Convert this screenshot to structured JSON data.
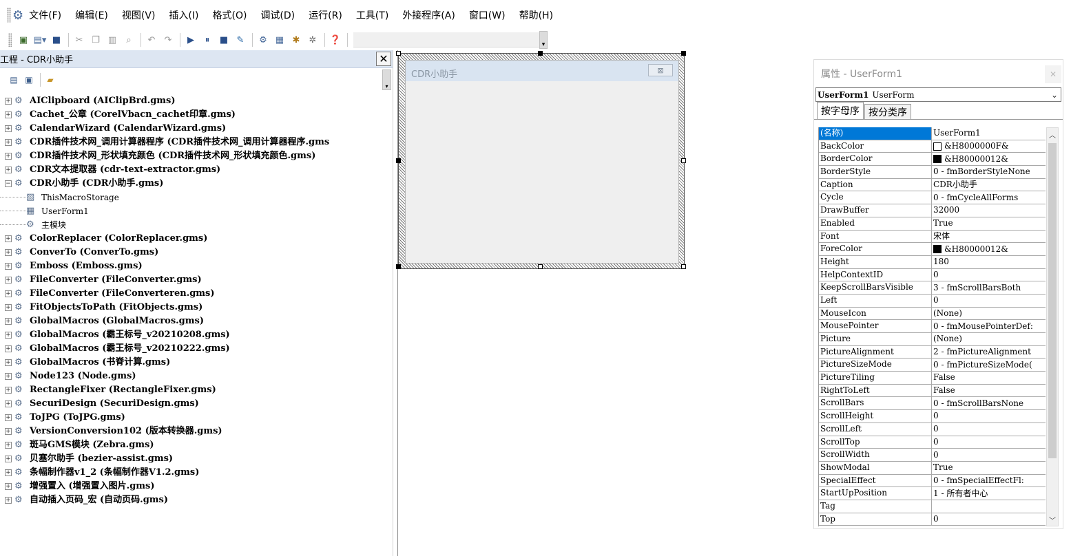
{
  "menu": {
    "items": [
      "文件(F)",
      "编辑(E)",
      "视图(V)",
      "插入(I)",
      "格式(O)",
      "调试(D)",
      "运行(R)",
      "工具(T)",
      "外接程序(A)",
      "窗口(W)",
      "帮助(H)"
    ]
  },
  "project": {
    "title": "工程 - CDR小助手",
    "items": [
      {
        "label": "AIClipboard (AIClipBrd.gms)",
        "expanded": false
      },
      {
        "label": "Cachet_公章 (CorelVbacn_cachet印章.gms)",
        "expanded": false
      },
      {
        "label": "CalendarWizard (CalendarWizard.gms)",
        "expanded": false
      },
      {
        "label": "CDR插件技术网_调用计算器程序 (CDR插件技术网_调用计算器程序.gms",
        "expanded": false
      },
      {
        "label": "CDR插件技术网_形状填充颜色 (CDR插件技术网_形状填充颜色.gms)",
        "expanded": false
      },
      {
        "label": "CDR文本提取器 (cdr-text-extractor.gms)",
        "expanded": false
      },
      {
        "label": "CDR小助手 (CDR小助手.gms)",
        "expanded": true
      },
      {
        "label": "ThisMacroStorage",
        "child": true,
        "icon": "document-icon"
      },
      {
        "label": "UserForm1",
        "child": true,
        "icon": "form-icon"
      },
      {
        "label": "主模块",
        "child": true,
        "icon": "module-icon"
      },
      {
        "label": "ColorReplacer (ColorReplacer.gms)",
        "expanded": false
      },
      {
        "label": "ConverTo (ConverTo.gms)",
        "expanded": false
      },
      {
        "label": "Emboss (Emboss.gms)",
        "expanded": false
      },
      {
        "label": "FileConverter (FileConverter.gms)",
        "expanded": false
      },
      {
        "label": "FileConverter (FileConverteren.gms)",
        "expanded": false
      },
      {
        "label": "FitObjectsToPath (FitObjects.gms)",
        "expanded": false
      },
      {
        "label": "GlobalMacros (GlobalMacros.gms)",
        "expanded": false
      },
      {
        "label": "GlobalMacros (霸王标号_v20210208.gms)",
        "expanded": false
      },
      {
        "label": "GlobalMacros (霸王标号_v20210222.gms)",
        "expanded": false
      },
      {
        "label": "GlobalMacros (书脊计算.gms)",
        "expanded": false
      },
      {
        "label": "Node123 (Node.gms)",
        "expanded": false
      },
      {
        "label": "RectangleFixer (RectangleFixer.gms)",
        "expanded": false
      },
      {
        "label": "SecuriDesign (SecuriDesign.gms)",
        "expanded": false
      },
      {
        "label": "ToJPG (ToJPG.gms)",
        "expanded": false
      },
      {
        "label": "VersionConversion102 (版本转换器.gms)",
        "expanded": false
      },
      {
        "label": "斑马GMS模块 (Zebra.gms)",
        "expanded": false
      },
      {
        "label": "贝塞尔助手 (bezier-assist.gms)",
        "expanded": false
      },
      {
        "label": "条幅制作器v1_2 (条幅制作器V1.2.gms)",
        "expanded": false
      },
      {
        "label": "增强置入 (增强置入图片.gms)",
        "expanded": false
      },
      {
        "label": "自动插入页码_宏 (自动页码.gms)",
        "expanded": false
      }
    ]
  },
  "userform": {
    "caption": "CDR小助手",
    "close_glyph": "⊠"
  },
  "properties": {
    "title": "属性 - UserForm1",
    "object_name": "UserForm1",
    "object_type": "UserForm",
    "tabs": [
      "按字母序",
      "按分类序"
    ],
    "rows": [
      {
        "name": "(名称)",
        "value": "UserForm1",
        "selected": true
      },
      {
        "name": "BackColor",
        "value": "&H8000000F&",
        "swatch": "#ffffff"
      },
      {
        "name": "BorderColor",
        "value": "&H80000012&",
        "swatch": "#000000"
      },
      {
        "name": "BorderStyle",
        "value": "0 - fmBorderStyleNone"
      },
      {
        "name": "Caption",
        "value": "CDR小助手"
      },
      {
        "name": "Cycle",
        "value": "0 - fmCycleAllForms"
      },
      {
        "name": "DrawBuffer",
        "value": "32000"
      },
      {
        "name": "Enabled",
        "value": "True"
      },
      {
        "name": "Font",
        "value": "宋体"
      },
      {
        "name": "ForeColor",
        "value": "&H80000012&",
        "swatch": "#000000"
      },
      {
        "name": "Height",
        "value": "180"
      },
      {
        "name": "HelpContextID",
        "value": "0"
      },
      {
        "name": "KeepScrollBarsVisible",
        "value": "3 - fmScrollBarsBoth"
      },
      {
        "name": "Left",
        "value": "0"
      },
      {
        "name": "MouseIcon",
        "value": "(None)"
      },
      {
        "name": "MousePointer",
        "value": "0 - fmMousePointerDef:"
      },
      {
        "name": "Picture",
        "value": "(None)"
      },
      {
        "name": "PictureAlignment",
        "value": "2 - fmPictureAlignment"
      },
      {
        "name": "PictureSizeMode",
        "value": "0 - fmPictureSizeMode("
      },
      {
        "name": "PictureTiling",
        "value": "False"
      },
      {
        "name": "RightToLeft",
        "value": "False"
      },
      {
        "name": "ScrollBars",
        "value": "0 - fmScrollBarsNone"
      },
      {
        "name": "ScrollHeight",
        "value": "0"
      },
      {
        "name": "ScrollLeft",
        "value": "0"
      },
      {
        "name": "ScrollTop",
        "value": "0"
      },
      {
        "name": "ScrollWidth",
        "value": "0"
      },
      {
        "name": "ShowModal",
        "value": "True"
      },
      {
        "name": "SpecialEffect",
        "value": "0 - fmSpecialEffectFl:"
      },
      {
        "name": "StartUpPosition",
        "value": "1 - 所有者中心"
      },
      {
        "name": "Tag",
        "value": ""
      },
      {
        "name": "Top",
        "value": "0"
      }
    ]
  },
  "icons": {
    "app": "vba-gear-icon",
    "close": "close-icon",
    "project_item": "gear-module-icon"
  }
}
